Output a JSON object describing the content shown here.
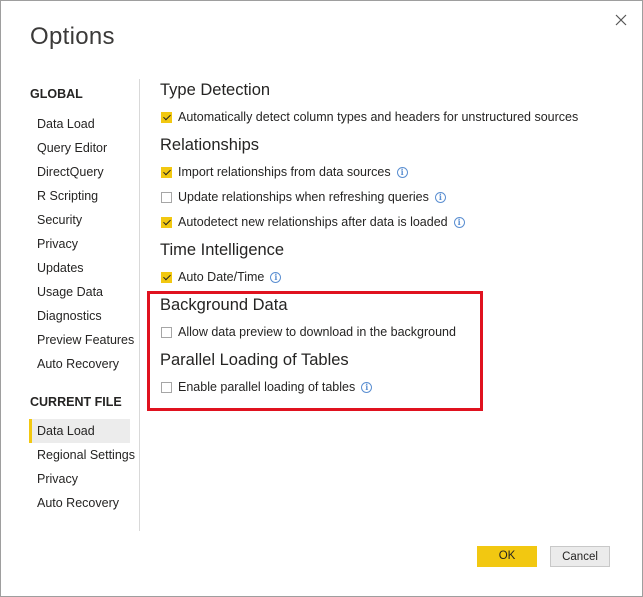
{
  "dialog": {
    "title": "Options"
  },
  "sidebar": {
    "global_label": "GLOBAL",
    "global_items": [
      "Data Load",
      "Query Editor",
      "DirectQuery",
      "R Scripting",
      "Security",
      "Privacy",
      "Updates",
      "Usage Data",
      "Diagnostics",
      "Preview Features",
      "Auto Recovery"
    ],
    "current_label": "CURRENT FILE",
    "current_items": [
      "Data Load",
      "Regional Settings",
      "Privacy",
      "Auto Recovery"
    ],
    "active_item": "Data Load (CURRENT FILE)"
  },
  "groups": {
    "type_detection": {
      "title": "Type Detection",
      "options": [
        {
          "label": "Automatically detect column types and headers for unstructured sources",
          "checked": true,
          "info": false
        }
      ]
    },
    "relationships": {
      "title": "Relationships",
      "options": [
        {
          "label": "Import relationships from data sources",
          "checked": true,
          "info": true
        },
        {
          "label": "Update relationships when refreshing queries",
          "checked": false,
          "info": true
        },
        {
          "label": "Autodetect new relationships after data is loaded",
          "checked": true,
          "info": true
        }
      ]
    },
    "time_intelligence": {
      "title": "Time Intelligence",
      "options": [
        {
          "label": "Auto Date/Time",
          "checked": true,
          "info": true
        }
      ]
    },
    "background_data": {
      "title": "Background Data",
      "options": [
        {
          "label": "Allow data preview to download in the background",
          "checked": false,
          "info": false
        }
      ]
    },
    "parallel_loading": {
      "title": "Parallel Loading of Tables",
      "options": [
        {
          "label": "Enable parallel loading of tables",
          "checked": false,
          "info": true
        }
      ]
    }
  },
  "footer": {
    "ok_label": "OK",
    "cancel_label": "Cancel"
  },
  "colors": {
    "accent": "#f2c811",
    "highlight": "#e0121f",
    "info": "#5b8fd1"
  }
}
